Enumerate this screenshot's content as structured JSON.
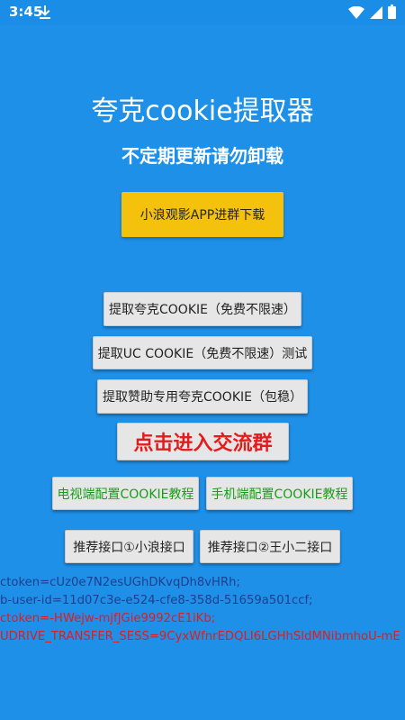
{
  "status_bar": {
    "time": "3:45",
    "icons": [
      "download-icon",
      "wifi-icon",
      "signal-icon",
      "battery-icon"
    ]
  },
  "app": {
    "title": "夸克cookie提取器",
    "subtitle": "不定期更新请勿卸载"
  },
  "buttons": {
    "download_app": "小浪观影APP进群下载",
    "extract_quark": "提取夸克COOKIE（免费不限速）",
    "extract_uc": "提取UC  COOKIE（免费不限速）测试",
    "extract_sponsor": "提取赞助专用夸克COOKIE（包稳）",
    "join_group": "点击进入交流群",
    "tv_tutorial": "电视端配置COOKIE教程",
    "phone_tutorial": "手机端配置COOKIE教程",
    "api1": "推荐接口①小浪接口",
    "api2": "推荐接口②王小二接口"
  },
  "cookie_output": {
    "line1": "ctoken=cUz0e7N2esUGhDKvqDh8vHRh;",
    "line2": "b-user-id=11d07c3e-e524-cfe8-358d-51659a501ccf;",
    "line3": "ctoken=-HWejw-mjfJGie9992cE1iKb;",
    "line4": "UDRIVE_TRANSFER_SESS=9CyxWfnrEDQLI6LGHhSIdMNibmhoU-mE"
  },
  "colors": {
    "background": "#1e90e8",
    "accent_yellow": "#f4c20d",
    "red_text": "#e21c1c",
    "green_text": "#1a9b1a",
    "cookie_blue": "#1f3f8f"
  }
}
